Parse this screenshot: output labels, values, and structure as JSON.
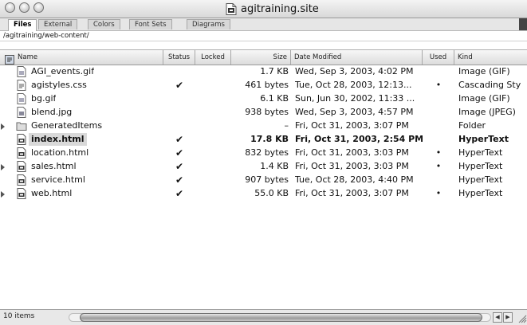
{
  "window": {
    "title": "agitraining.site"
  },
  "tabs": [
    "Files",
    "External",
    "Colors",
    "Font Sets",
    "Diagrams"
  ],
  "path": "/agitraining/web-content/",
  "columns": {
    "name": "Name",
    "status": "Status",
    "locked": "Locked",
    "size": "Size",
    "date": "Date Modified",
    "used": "Used",
    "kind": "Kind"
  },
  "files": [
    {
      "name": "AGI_events.gif",
      "status": "",
      "size": "1.7 KB",
      "date": "Wed, Sep 3, 2003, 4:02 PM",
      "used": "",
      "kind": "Image (GIF)",
      "icon": "gif-image-icon",
      "disclosure": false,
      "bold": false
    },
    {
      "name": "agistyles.css",
      "status": "✔",
      "size": "461 bytes",
      "date": "Tue, Oct 28, 2003, 12:13...",
      "used": "•",
      "kind": "Cascading Sty",
      "icon": "css-file-icon",
      "disclosure": false,
      "bold": false
    },
    {
      "name": "bg.gif",
      "status": "",
      "size": "6.1 KB",
      "date": "Sun, Jun 30, 2002, 11:33 ...",
      "used": "",
      "kind": "Image (GIF)",
      "icon": "gif-image-icon",
      "disclosure": false,
      "bold": false
    },
    {
      "name": "blend.jpg",
      "status": "",
      "size": "938 bytes",
      "date": "Wed, Sep 3, 2003, 4:57 PM",
      "used": "",
      "kind": "Image (JPEG)",
      "icon": "jpeg-image-icon",
      "disclosure": false,
      "bold": false
    },
    {
      "name": "GeneratedItems",
      "status": "",
      "size": "–",
      "date": "Fri, Oct 31, 2003, 3:07 PM",
      "used": "",
      "kind": "Folder",
      "icon": "folder-icon",
      "disclosure": true,
      "bold": false
    },
    {
      "name": "index.html",
      "status": "✔",
      "size": "17.8 KB",
      "date": "Fri, Oct 31, 2003, 2:54 PM",
      "used": "",
      "kind": "HyperText",
      "icon": "html-file-icon",
      "disclosure": false,
      "bold": true
    },
    {
      "name": "location.html",
      "status": "✔",
      "size": "832 bytes",
      "date": "Fri, Oct 31, 2003, 3:03 PM",
      "used": "•",
      "kind": "HyperText",
      "icon": "html-file-icon",
      "disclosure": false,
      "bold": false
    },
    {
      "name": "sales.html",
      "status": "✔",
      "size": "1.4 KB",
      "date": "Fri, Oct 31, 2003, 3:03 PM",
      "used": "•",
      "kind": "HyperText",
      "icon": "html-file-icon",
      "disclosure": true,
      "bold": false
    },
    {
      "name": "service.html",
      "status": "✔",
      "size": "907 bytes",
      "date": "Tue, Oct 28, 2003, 4:40 PM",
      "used": "",
      "kind": "HyperText",
      "icon": "html-file-icon",
      "disclosure": false,
      "bold": false
    },
    {
      "name": "web.html",
      "status": "✔",
      "size": "55.0 KB",
      "date": "Fri, Oct 31, 2003, 3:07 PM",
      "used": "•",
      "kind": "HyperText",
      "icon": "html-file-icon",
      "disclosure": true,
      "bold": false
    }
  ],
  "status_bar": {
    "item_count": "10 items"
  }
}
